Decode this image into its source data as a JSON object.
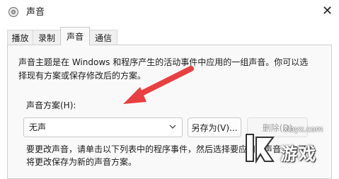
{
  "window": {
    "title": "声音",
    "close_glyph": "✕"
  },
  "tabs": [
    {
      "label": "播放",
      "active": false
    },
    {
      "label": "录制",
      "active": false
    },
    {
      "label": "声音",
      "active": true
    },
    {
      "label": "通信",
      "active": false
    }
  ],
  "sounds": {
    "description": "声音主题是在 Windows 和程序产生的活动事件中应用的一组声音。你可以选择现有方案或保存修改后的方案。",
    "scheme_label": "声音方案(H):",
    "scheme_selected": "无声",
    "save_as_label": "另存为(V)...",
    "delete_label": "删除(D)",
    "bottom_description": "要更改声音，请单击以下列表中的程序事件，然后选择要应用的声音。你可以将更改保存为新的声音方案。"
  },
  "watermark": {
    "domain": "xiayx.com",
    "name": "游戏"
  },
  "colors": {
    "arrow": "#e84040",
    "panel_bg": "#f9f9f9",
    "border": "#cfcfcf"
  },
  "icons": {
    "app": "speaker-icon",
    "close": "close-icon",
    "dropdown": "chevron-down-icon"
  }
}
